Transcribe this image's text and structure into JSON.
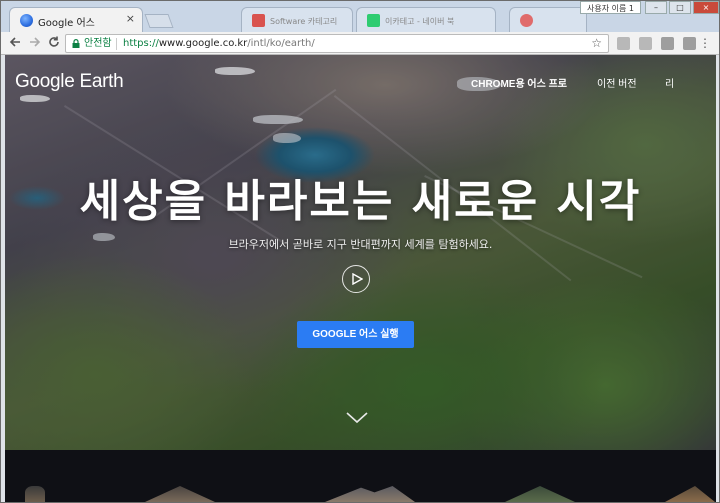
{
  "browser": {
    "active_tab": {
      "title": "Google 어스",
      "close_icon": "×"
    },
    "background_tabs": [
      "",
      "Software 카테고리",
      "",
      "이카테고 - 네이버 북",
      ""
    ],
    "window_label": "사용자 이름 1",
    "window_buttons": {
      "minimize": "–",
      "maximize": "□",
      "close": "×"
    },
    "secure_label": "안전함",
    "url_scheme": "https://",
    "url_host": "www.google.co.kr",
    "url_path": "/intl/ko/earth/",
    "menu_glyph": "⋮"
  },
  "page": {
    "logo": "Google Earth",
    "nav": {
      "chrome_label": "CHROME용 어스 프로",
      "prev_version": "이전 버전",
      "more": "리"
    },
    "headline": "세상을 바라보는 새로운 시각",
    "subhead": "브라우저에서 곧바로 지구 반대편까지 세계를 탐험하세요.",
    "cta_label": "GOOGLE 어스 실행"
  },
  "colors": {
    "cta": "#2b7cf3",
    "secure": "#0b8043",
    "band": "#0f1015"
  },
  "icons": [
    "chrome-icon",
    "back-icon",
    "forward-icon",
    "reload-icon",
    "lock-icon",
    "star-icon",
    "play-icon",
    "chevron-down-icon",
    "kebab-menu-icon"
  ]
}
